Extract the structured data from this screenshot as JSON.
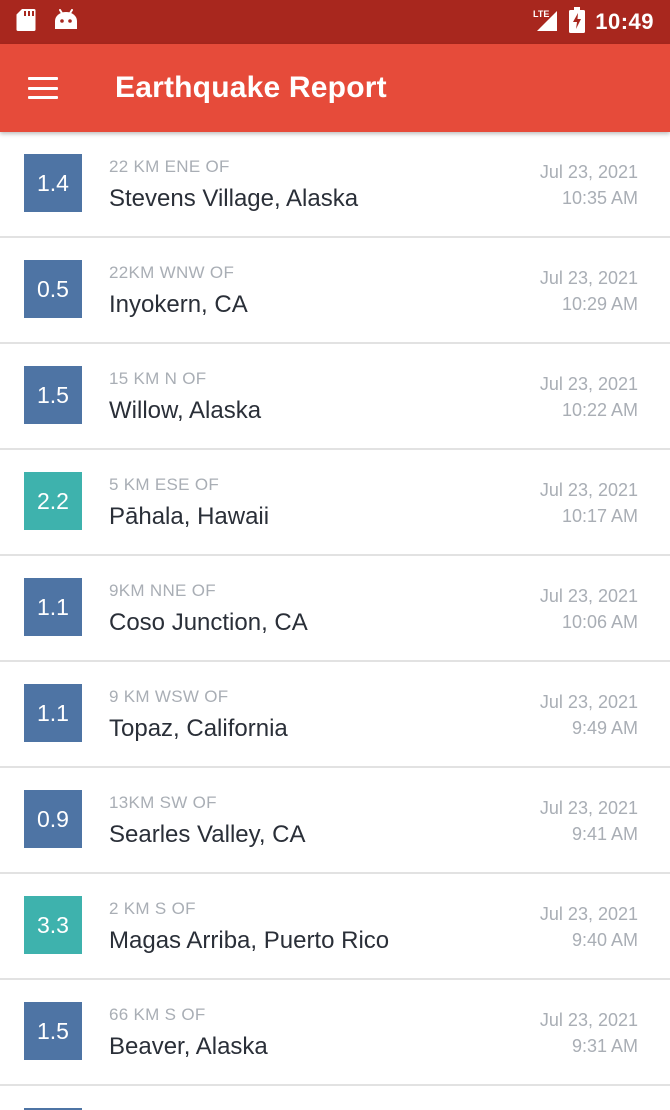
{
  "status_bar": {
    "time": "10:49",
    "network": "LTE",
    "left_icons": [
      "sd-card-icon",
      "android-icon"
    ],
    "color": "#a8271e"
  },
  "app_bar": {
    "title": "Earthquake Report",
    "color": "#e64b3a"
  },
  "colors": {
    "mag_low": "#4e74a4",
    "mag_mid": "#3eb2ad"
  },
  "earthquakes": [
    {
      "mag": "1.4",
      "offset": "22 KM ENE OF",
      "place": "Stevens Village, Alaska",
      "date": "Jul 23, 2021",
      "time": "10:35 AM",
      "color": "#4e74a4"
    },
    {
      "mag": "0.5",
      "offset": "22KM WNW OF",
      "place": "Inyokern, CA",
      "date": "Jul 23, 2021",
      "time": "10:29 AM",
      "color": "#4e74a4"
    },
    {
      "mag": "1.5",
      "offset": "15 KM N OF",
      "place": "Willow, Alaska",
      "date": "Jul 23, 2021",
      "time": "10:22 AM",
      "color": "#4e74a4"
    },
    {
      "mag": "2.2",
      "offset": "5 KM ESE OF",
      "place": "Pāhala, Hawaii",
      "date": "Jul 23, 2021",
      "time": "10:17 AM",
      "color": "#3eb2ad"
    },
    {
      "mag": "1.1",
      "offset": "9KM NNE OF",
      "place": "Coso Junction, CA",
      "date": "Jul 23, 2021",
      "time": "10:06 AM",
      "color": "#4e74a4"
    },
    {
      "mag": "1.1",
      "offset": "9 KM WSW OF",
      "place": "Topaz, California",
      "date": "Jul 23, 2021",
      "time": "9:49 AM",
      "color": "#4e74a4"
    },
    {
      "mag": "0.9",
      "offset": "13KM SW OF",
      "place": "Searles Valley, CA",
      "date": "Jul 23, 2021",
      "time": "9:41 AM",
      "color": "#4e74a4"
    },
    {
      "mag": "3.3",
      "offset": "2 KM S OF",
      "place": "Magas Arriba, Puerto Rico",
      "date": "Jul 23, 2021",
      "time": "9:40 AM",
      "color": "#3eb2ad"
    },
    {
      "mag": "1.5",
      "offset": "66 KM S OF",
      "place": "Beaver, Alaska",
      "date": "Jul 23, 2021",
      "time": "9:31 AM",
      "color": "#4e74a4"
    }
  ]
}
